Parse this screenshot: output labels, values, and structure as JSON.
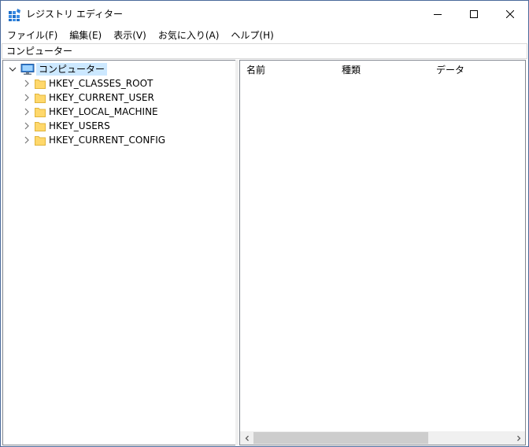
{
  "window": {
    "title": "レジストリ エディター",
    "icon": "regedit-icon"
  },
  "controls": {
    "minimize": "minimize-icon",
    "maximize": "maximize-icon",
    "close": "close-icon"
  },
  "menu": {
    "items": [
      {
        "label": "ファイル(F)"
      },
      {
        "label": "編集(E)"
      },
      {
        "label": "表示(V)"
      },
      {
        "label": "お気に入り(A)"
      },
      {
        "label": "ヘルプ(H)"
      }
    ]
  },
  "address": {
    "value": "コンピューター"
  },
  "tree": {
    "root": {
      "label": "コンピューター",
      "expanded": true,
      "selected": true
    },
    "nodes": [
      {
        "label": "HKEY_CLASSES_ROOT"
      },
      {
        "label": "HKEY_CURRENT_USER"
      },
      {
        "label": "HKEY_LOCAL_MACHINE"
      },
      {
        "label": "HKEY_USERS"
      },
      {
        "label": "HKEY_CURRENT_CONFIG"
      }
    ]
  },
  "list": {
    "columns": [
      {
        "label": "名前"
      },
      {
        "label": "種類"
      },
      {
        "label": "データ"
      }
    ]
  },
  "colors": {
    "selection": "#cce8ff",
    "folder": "#ffd86b",
    "border": "#828790"
  }
}
